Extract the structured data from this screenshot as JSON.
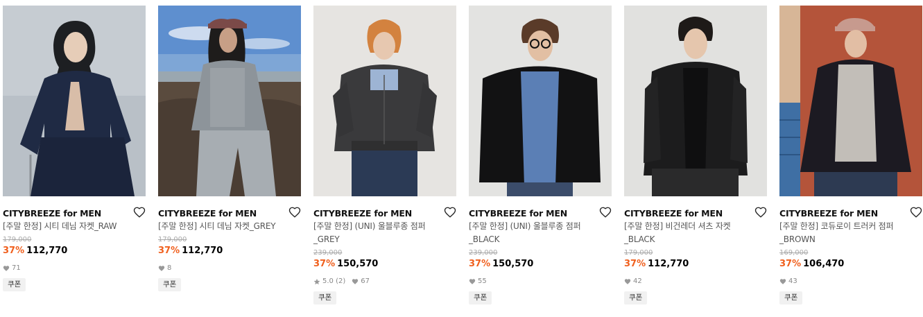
{
  "products": [
    {
      "brand": "CITYBREEZE for MEN",
      "title": "[주말 한정] 시티 데님 자켓_RAW",
      "original_price": "179,000",
      "discount": "37%",
      "price": "112,770",
      "rating": "",
      "reviews": "",
      "likes": "71",
      "coupon": "쿠폰"
    },
    {
      "brand": "CITYBREEZE for MEN",
      "title": "[주말 한정] 시티 데님 자켓_GREY",
      "original_price": "179,000",
      "discount": "37%",
      "price": "112,770",
      "rating": "",
      "reviews": "",
      "likes": "8",
      "coupon": "쿠폰"
    },
    {
      "brand": "CITYBREEZE for MEN",
      "title": "[주말 한정] (UNI) 울블루종 점퍼 _GREY",
      "original_price": "239,000",
      "discount": "37%",
      "price": "150,570",
      "rating": "5.0",
      "reviews": "(2)",
      "likes": "67",
      "coupon": "쿠폰"
    },
    {
      "brand": "CITYBREEZE for MEN",
      "title": "[주말 한정] (UNI) 울블루종 점퍼 _BLACK",
      "original_price": "239,000",
      "discount": "37%",
      "price": "150,570",
      "rating": "",
      "reviews": "",
      "likes": "55",
      "coupon": "쿠폰"
    },
    {
      "brand": "CITYBREEZE for MEN",
      "title": "[주말 한정] 비건레더 셔츠 자켓 _BLACK",
      "original_price": "179,000",
      "discount": "37%",
      "price": "112,770",
      "rating": "",
      "reviews": "",
      "likes": "42",
      "coupon": "쿠폰"
    },
    {
      "brand": "CITYBREEZE for MEN",
      "title": "[주말 한정] 코듀로이 트러커 점퍼 _BROWN",
      "original_price": "169,000",
      "discount": "37%",
      "price": "106,470",
      "rating": "",
      "reviews": "",
      "likes": "43",
      "coupon": "쿠폰"
    }
  ],
  "icons": {
    "wishlist": "heart-outline-icon",
    "likes": "heart-filled-icon",
    "rating": "star-icon"
  },
  "colors": {
    "discount": "#f0601e",
    "muted": "#888888",
    "badge_bg": "#f1f1f1"
  }
}
